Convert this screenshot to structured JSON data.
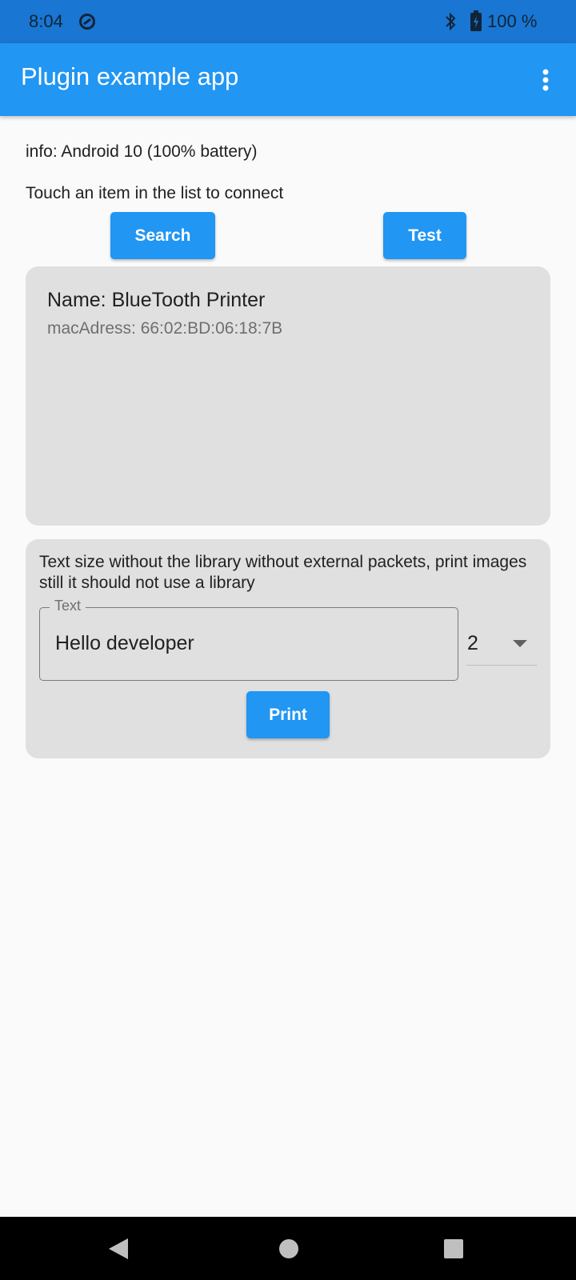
{
  "status_bar": {
    "time": "8:04",
    "battery": "100 %"
  },
  "app_bar": {
    "title": "Plugin example app"
  },
  "info_text": "info: Android 10 (100% battery)",
  "instructions": "Touch an item in the list to connect",
  "buttons": {
    "search": "Search",
    "test": "Test",
    "print": "Print"
  },
  "device_list": [
    {
      "name": "Name: BlueTooth Printer",
      "mac": "macAdress: 66:02:BD:06:18:7B"
    }
  ],
  "print_panel": {
    "description": "Text size without the library without external packets, print images still it should not use a library",
    "text_field_label": "Text",
    "text_field_value": "Hello developer",
    "size_value": "2"
  },
  "colors": {
    "primary": "#2196f3",
    "status_bar": "#1976d2",
    "card": "#e0e0e0",
    "background": "#fafafa"
  }
}
